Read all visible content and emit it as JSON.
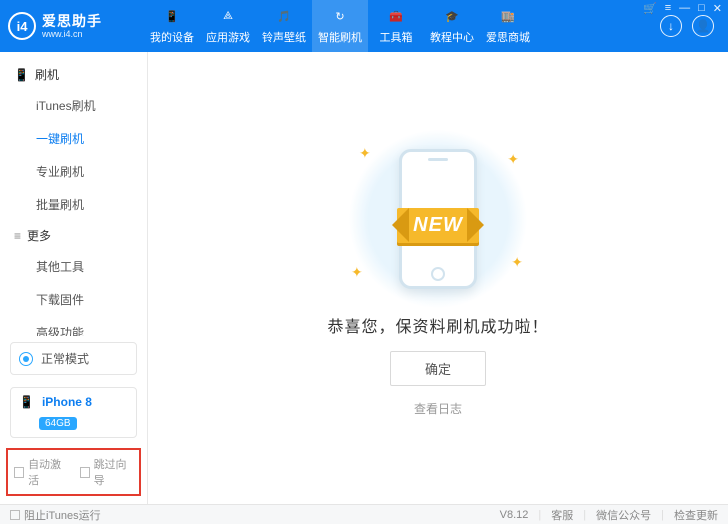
{
  "brand": {
    "logo_text": "i4",
    "title": "爱思助手",
    "subtitle": "www.i4.cn"
  },
  "window_controls": {
    "cart": "🛒",
    "menu": "≡",
    "min": "—",
    "max": "□",
    "close": "✕"
  },
  "header_actions": {
    "download": "↓",
    "user": "👤"
  },
  "nav": [
    {
      "label": "我的设备",
      "icon": "📱"
    },
    {
      "label": "应用游戏",
      "icon": "⟁"
    },
    {
      "label": "铃声壁纸",
      "icon": "🎵"
    },
    {
      "label": "智能刷机",
      "icon": "↻",
      "active": true
    },
    {
      "label": "工具箱",
      "icon": "🧰"
    },
    {
      "label": "教程中心",
      "icon": "🎓"
    },
    {
      "label": "爱思商城",
      "icon": "🏬"
    }
  ],
  "sidebar": {
    "groups": [
      {
        "icon": "📱",
        "title": "刷机",
        "items": [
          {
            "label": "iTunes刷机"
          },
          {
            "label": "一键刷机",
            "active": true
          },
          {
            "label": "专业刷机"
          },
          {
            "label": "批量刷机"
          }
        ]
      },
      {
        "icon": "≡",
        "title": "更多",
        "items": [
          {
            "label": "其他工具"
          },
          {
            "label": "下载固件"
          },
          {
            "label": "高级功能"
          }
        ]
      }
    ],
    "mode": {
      "label": "正常模式"
    },
    "device": {
      "name": "iPhone 8",
      "storage": "64GB"
    },
    "options": {
      "auto_activate": "自动激活",
      "skip_wizard": "跳过向导"
    }
  },
  "main": {
    "ribbon": "NEW",
    "message": "恭喜您，保资料刷机成功啦！",
    "ok": "确定",
    "view_log": "查看日志"
  },
  "footer": {
    "block_itunes": "阻止iTunes运行",
    "version": "V8.12",
    "support": "客服",
    "wechat": "微信公众号",
    "update": "检查更新"
  }
}
